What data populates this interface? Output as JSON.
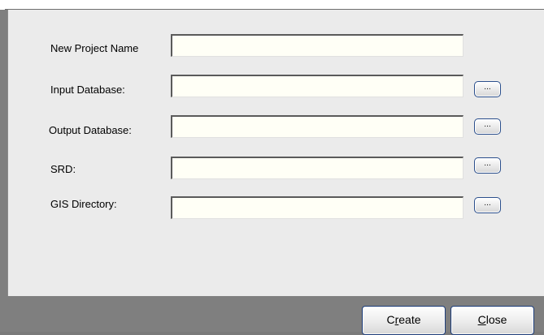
{
  "form": {
    "fields": [
      {
        "label": "New Project Name",
        "value": "",
        "has_browse": false
      },
      {
        "label": "Input Database:",
        "value": "",
        "has_browse": true
      },
      {
        "label": "Output Database:",
        "value": "",
        "has_browse": true
      },
      {
        "label": "SRD:",
        "value": "",
        "has_browse": true
      },
      {
        "label": "GIS Directory:",
        "value": "",
        "has_browse": true
      }
    ],
    "browse_label": "...",
    "browse_icon": "ellipsis-icon"
  },
  "footer": {
    "create_mnemonic_pre": "C",
    "create_mnemonic": "r",
    "create_mnemonic_post": "eate",
    "close_mnemonic": "C",
    "close_mnemonic_post": "lose"
  },
  "colors": {
    "panel_bg": "#ebebeb",
    "footer_bg": "#7f7f7f",
    "field_bg": "#fffff6",
    "button_border": "#1d3d7a"
  }
}
